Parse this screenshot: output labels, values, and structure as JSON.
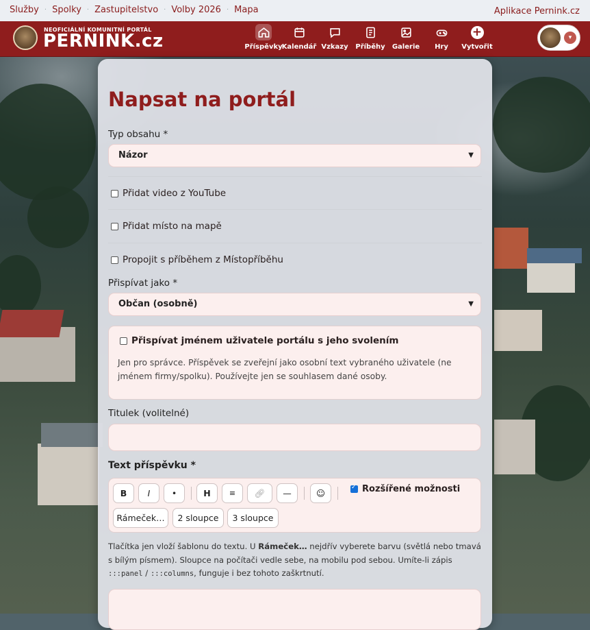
{
  "topbar": {
    "links": [
      "Služby",
      "Spolky",
      "Zastupitelstvo",
      "Volby 2026",
      "Mapa"
    ],
    "app_link": "Aplikace Pernink.cz"
  },
  "brand": {
    "tagline": "NEOFICIÁLNÍ KOMUNITNÍ PORTÁL",
    "name": "PERNINK.cz"
  },
  "nav": {
    "items": [
      {
        "label": "Příspěvky",
        "icon": "home-icon",
        "active": true
      },
      {
        "label": "Kalendář",
        "icon": "calendar-icon"
      },
      {
        "label": "Vzkazy",
        "icon": "message-icon"
      },
      {
        "label": "Příběhy",
        "icon": "book-icon"
      },
      {
        "label": "Galerie",
        "icon": "image-icon"
      },
      {
        "label": "Hry",
        "icon": "gamepad-icon"
      },
      {
        "label": "Vytvořit",
        "icon": "plus-icon"
      }
    ]
  },
  "form": {
    "title": "Napsat na portál",
    "content_type_label": "Typ obsahu *",
    "content_type_value": "Názor",
    "checkboxes": [
      {
        "label": "Přidat video z YouTube",
        "checked": false
      },
      {
        "label": "Přidat místo na mapě",
        "checked": false
      },
      {
        "label": "Propojit s příběhem z Místopříběhu",
        "checked": false
      }
    ],
    "post_as_label": "Přispívat jako *",
    "post_as_value": "Občan (osobně)",
    "on_behalf": {
      "label": "Přispívat jménem uživatele portálu s jeho svolením",
      "checked": false,
      "note": "Jen pro správce. Příspěvek se zveřejní jako osobní text vybraného uživatele (ne jménem firmy/spolku). Používejte jen se souhlasem dané osoby."
    },
    "title_label": "Titulek (volitelné)",
    "title_value": "",
    "text_label": "Text příspěvku *",
    "toolbar": {
      "bold": "B",
      "italic": "I",
      "bullet": "•",
      "heading": "H",
      "list": "≡",
      "link_icon": "link-icon",
      "hr": "—",
      "emoji": "☺",
      "advanced_label": "Rozšířené možnosti",
      "advanced_checked": true,
      "frame": "Rámeček…",
      "two_cols": "2 sloupce",
      "three_cols": "3 sloupce"
    },
    "help": {
      "part1": "Tlačítka jen vloží šablonu do textu. U ",
      "bold": "Rámeček…",
      "part2": " nejdřív vyberete barvu (světlá nebo tmavá s bílým písmem). Sloupce na počítači vedle sebe, na mobilu pod sebou. Umíte-li zápis ",
      "code1": ":::panel",
      "part3": " / ",
      "code2": ":::columns",
      "part4": ", funguje i bez tohoto zaškrtnutí."
    }
  },
  "colors": {
    "brand": "#8f1d1d",
    "field_bg": "#fcefee",
    "panel_bg": "#dfe2e8"
  }
}
